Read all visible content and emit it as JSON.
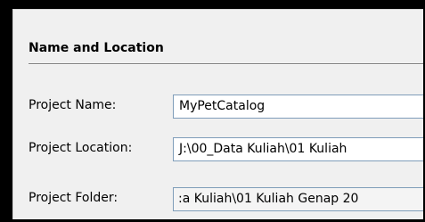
{
  "section": {
    "title": "Name and Location"
  },
  "fields": {
    "project_name": {
      "label": "Project Name:",
      "value": "MyPetCatalog"
    },
    "project_location": {
      "label": "Project Location:",
      "value": "J:\\00_Data Kuliah\\01 Kuliah"
    },
    "project_folder": {
      "label": "Project Folder:",
      "value": ":a Kuliah\\01 Kuliah Genap 20"
    }
  },
  "colors": {
    "frame": "#000000",
    "panel_background": "#f0f0f0",
    "field_border": "#7f9db9",
    "separator": "#7a7a7a"
  }
}
